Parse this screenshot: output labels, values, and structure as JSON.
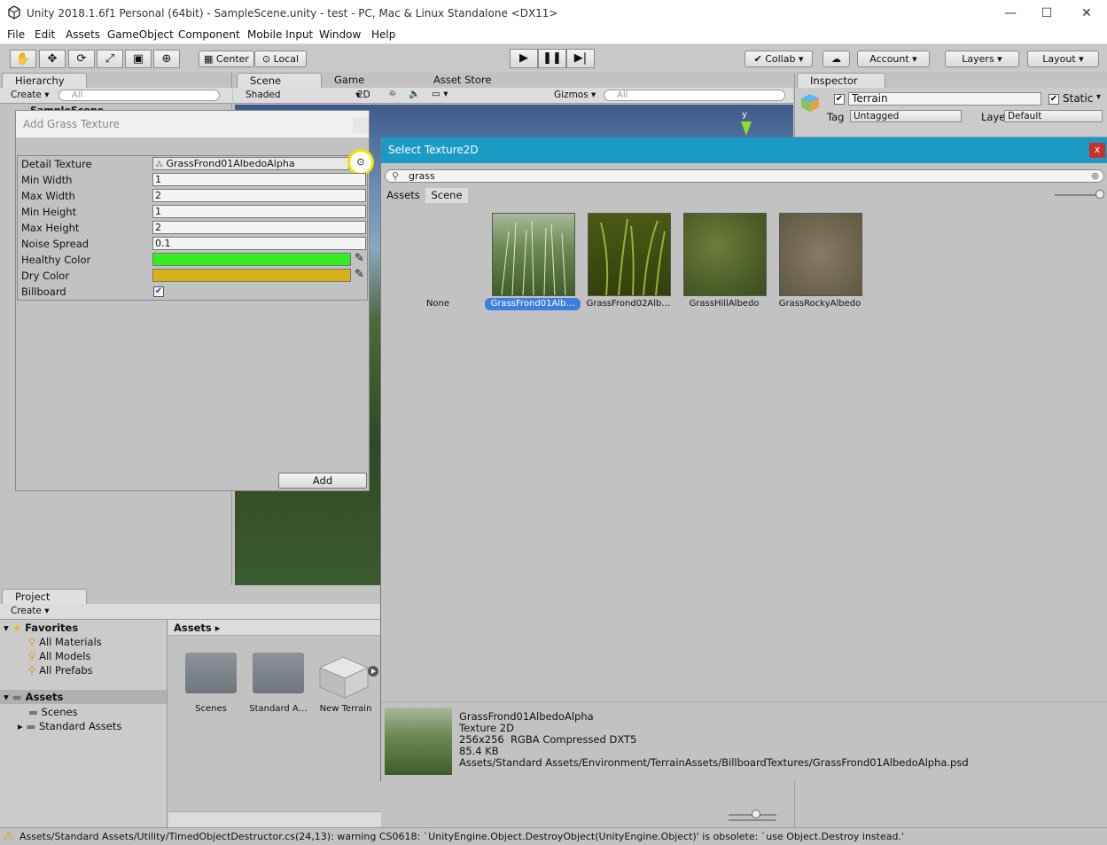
{
  "window": {
    "title": "Unity 2018.1.6f1 Personal (64bit) - SampleScene.unity - test - PC, Mac & Linux Standalone <DX11>",
    "controls": [
      "—",
      "☐",
      "✕"
    ]
  },
  "menu": [
    "File",
    "Edit",
    "Assets",
    "GameObject",
    "Component",
    "Mobile Input",
    "Window",
    "Help"
  ],
  "toolbar": {
    "tools": [
      "hand-tool",
      "move-tool",
      "rotate-tool",
      "scale-tool",
      "rect-tool",
      "transform-tool"
    ],
    "pivot": "Center",
    "space": "Local",
    "collab": "Collab",
    "account": "Account",
    "layers": "Layers",
    "layout": "Layout"
  },
  "hierarchy": {
    "tab": "Hierarchy",
    "create": "Create",
    "search": "All",
    "scene": "SampleScene"
  },
  "scene_view": {
    "tabs": [
      "Scene",
      "Game",
      "Asset Store"
    ],
    "shading": "Shaded",
    "mode_2d": "2D",
    "gizmos": "Gizmos",
    "search": "All",
    "axis_label": "y"
  },
  "inspector": {
    "tab": "Inspector",
    "object_name": "Terrain",
    "static_label": "Static",
    "tag_label": "Tag",
    "tag_value": "Untagged",
    "layer_label": "Layer",
    "layer_value": "Default"
  },
  "add_grass": {
    "title": "Add Grass Texture",
    "rows": [
      {
        "label": "Detail Texture",
        "value": "GrassFrond01AlbedoAlpha"
      },
      {
        "label": "Min Width",
        "value": "1"
      },
      {
        "label": "Max Width",
        "value": "2"
      },
      {
        "label": "Min Height",
        "value": "1"
      },
      {
        "label": "Max Height",
        "value": "2"
      },
      {
        "label": "Noise Spread",
        "value": "0.1"
      },
      {
        "label": "Healthy Color",
        "value": ""
      },
      {
        "label": "Dry Color",
        "value": ""
      },
      {
        "label": "Billboard",
        "value": ""
      }
    ],
    "healthy_color": "#33ee22",
    "dry_color": "#d6b21a",
    "billboard_checked": true,
    "add_button": "Add"
  },
  "select_texture": {
    "title": "Select Texture2D",
    "close": "x",
    "search": "grass",
    "tabs": [
      "Assets",
      "Scene"
    ],
    "items": [
      {
        "label": "None"
      },
      {
        "label": "GrassFrond01Alb…",
        "selected": true
      },
      {
        "label": "GrassFrond02Alb…"
      },
      {
        "label": "GrassHillAlbedo"
      },
      {
        "label": "GrassRockyAlbedo"
      }
    ],
    "preview": {
      "name": "GrassFrond01AlbedoAlpha",
      "type": "Texture 2D",
      "format": "256x256  RGBA Compressed DXT5",
      "size": "85.4 KB",
      "path": "Assets/Standard Assets/Environment/TerrainAssets/BillboardTextures/GrassFrond01AlbedoAlpha.psd"
    }
  },
  "project": {
    "tab": "Project",
    "create": "Create",
    "favorites": "Favorites",
    "favorite_items": [
      "All Materials",
      "All Models",
      "All Prefabs"
    ],
    "assets_root": "Assets",
    "asset_folders": [
      "Scenes",
      "Standard Assets"
    ],
    "breadcrumb": "Assets",
    "grid_items": [
      "Scenes",
      "Standard A…",
      "New Terrain"
    ]
  },
  "status": "Assets/Standard Assets/Utility/TimedObjectDestructor.cs(24,13): warning CS0618: `UnityEngine.Object.DestroyObject(UnityEngine.Object)' is obsolete: `use Object.Destroy instead.'"
}
